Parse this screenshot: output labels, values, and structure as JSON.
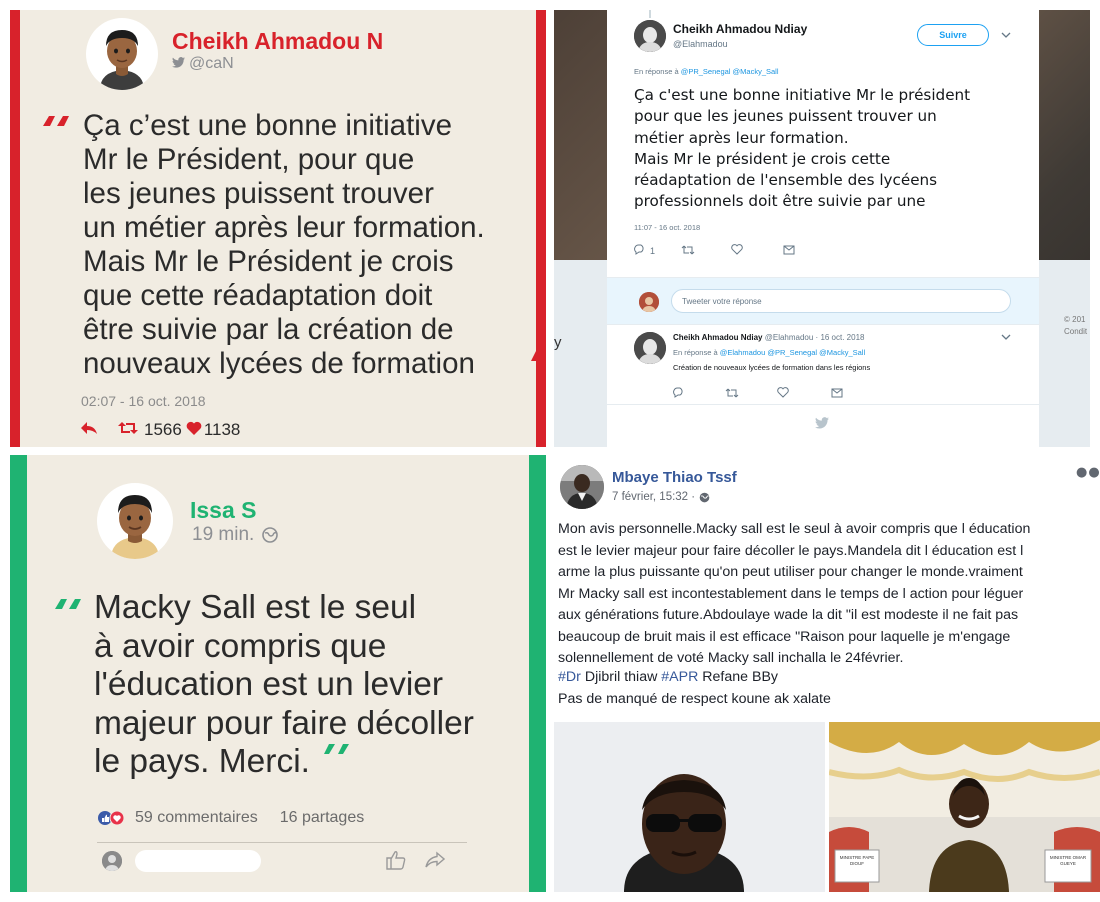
{
  "panel_quote_twitter": {
    "author_name": "Cheikh Ahmadou N",
    "handle": "@caN",
    "quote": "Ça c’est une bonne initiative\nMr le Président, pour que\nles jeunes puissent trouver\nun métier après leur formation.\nMais Mr le Président je crois\nque cette réadaptation doit\nêtre suivie par la création de\nnouveaux lycées de formation",
    "timestamp": "02:07 - 16 oct. 2018",
    "retweets": "1566",
    "likes": "1138",
    "colors": {
      "accent": "#d8222b",
      "background": "#f1ece2"
    },
    "icons": [
      "twitter-bird-icon",
      "reply-icon",
      "retweet-icon",
      "heart-icon"
    ]
  },
  "panel_twitter_screenshot": {
    "author_name": "Cheikh Ahmadou Ndiay",
    "handle": "@Elahmadou",
    "follow_label": "Suivre",
    "reply_to_prefix": "En réponse à",
    "reply_to_mentions": "@PR_Senegal @Macky_Sall",
    "tweet_text": "Ça c'est une bonne initiative Mr le président\npour que les jeunes puissent trouver un\nmétier après leur formation.\nMais Mr le président je crois cette\nréadaptation de l'ensemble des lycéens\nprofessionnels doit être suivie par une",
    "timestamp": "11:07 - 16 oct. 2018",
    "reply_count": "1",
    "composer_placeholder": "Tweeter votre réponse",
    "reply": {
      "author_name": "Cheikh Ahmadou Ndiay",
      "meta": "@Elahmadou · 16 oct. 2018",
      "reply_to_prefix": "En réponse à",
      "reply_to_mentions": "@Elahmadou @PR_Senegal @Macky_Sall",
      "text": "Création de nouveaux lycées de formation dans les régions"
    },
    "background_text_left": "y",
    "background_text_right": "© 201\nCondit",
    "colors": {
      "link": "#1b95e0",
      "follow": "#1da1f2"
    }
  },
  "panel_quote_facebook": {
    "author_name": "Issa S",
    "time_ago": "19 min.",
    "quote": "Macky Sall est le seul\nà avoir compris que\nl'éducation est un levier\nmajeur pour faire décoller\nle pays. Merci.",
    "comments": "59 commentaires",
    "shares": "16 partages",
    "colors": {
      "accent": "#1fb372",
      "background": "#f1ece2"
    },
    "icons": [
      "globe-icon",
      "reactions-icon",
      "like-icon",
      "share-icon"
    ]
  },
  "panel_facebook_post": {
    "author_name": "Mbaye Thiao Tssf",
    "date": "7 février, 15:32 ·",
    "body": "Mon avis personnelle.Macky sall est le seul à avoir compris que l éducation\nest le levier majeur pour faire décoller le pays.Mandela dit l éducation est l\narme la plus puissante qu'on peut utiliser pour changer le monde.vraiment\nMr Macky sall est incontestablement dans le temps de l action pour léguer\naux générations future.Abdoulaye wade la dit \"il est modeste il ne fait pas\nbeaucoup de bruit mais il est efficace \"Raison pour laquelle je m'engage\nsolennellement de voté Macky sall inchalla le 24février.",
    "tag1": "#Dr",
    "tag1_rest": " Djibril thiaw ",
    "tag2": "#APR",
    "tag2_rest": " Refane BBy",
    "closing": "Pas de manqué de respect koune ak xalate",
    "photo_signs": [
      "MINISTRE PAPE DIOUF",
      "MINISTRE OMAR GUEYE"
    ],
    "colors": {
      "name": "#365899"
    }
  }
}
